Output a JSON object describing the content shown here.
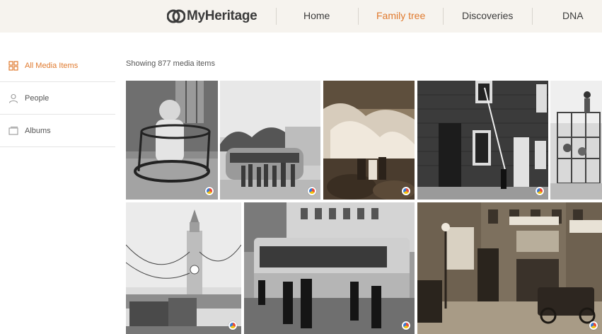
{
  "header": {
    "logo_text": "MyHeritage",
    "nav": [
      {
        "label": "Home"
      },
      {
        "label": "Family tree"
      },
      {
        "label": "Discoveries"
      },
      {
        "label": "DNA"
      }
    ],
    "active_nav": "Family tree",
    "accent_color": "#e07a2e"
  },
  "sidebar": {
    "items": [
      {
        "label": "All Media Items",
        "icon": "grid-icon"
      },
      {
        "label": "People",
        "icon": "person-icon"
      },
      {
        "label": "Albums",
        "icon": "album-icon"
      }
    ],
    "active_item": "All Media Items"
  },
  "main": {
    "count_text": "Showing 877 media items"
  }
}
